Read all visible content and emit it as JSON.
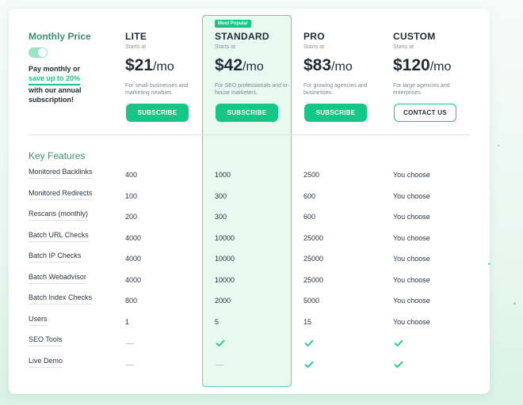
{
  "monthly_price": {
    "title": "Monthly Price",
    "pay_line1": "Pay monthly or",
    "save_text": "save up to 20%",
    "pay_line2": "with our annual subscription!"
  },
  "popular_badge": "Most Popular",
  "plans": [
    {
      "name": "LITE",
      "starts": "Starts at",
      "price": "$21",
      "per": "/mo",
      "desc": "For small businesses and marketing newbies.",
      "button": "SUBSCRIBE"
    },
    {
      "name": "STANDARD",
      "starts": "Starts at",
      "price": "$42",
      "per": "/mo",
      "desc": "For SEO professionals and in-house marketers.",
      "button": "SUBSCRIBE"
    },
    {
      "name": "PRO",
      "starts": "Starts at",
      "price": "$83",
      "per": "/mo",
      "desc": "For growing agencies and businesses.",
      "button": "SUBSCRIBE"
    },
    {
      "name": "CUSTOM",
      "starts": "Starts at",
      "price": "$120",
      "per": "/mo",
      "desc": "For large agencies and enterprises.",
      "button": "CONTACT US"
    }
  ],
  "key_features_title": "Key Features",
  "features": [
    {
      "label": "Monitored Backlinks",
      "values": [
        "400",
        "1000",
        "2500",
        "You choose"
      ]
    },
    {
      "label": "Monitored Redirects",
      "values": [
        "100",
        "300",
        "600",
        "You choose"
      ]
    },
    {
      "label": "Rescans (monthly)",
      "values": [
        "200",
        "300",
        "600",
        "You choose"
      ]
    },
    {
      "label": "Batch URL Checks",
      "values": [
        "4000",
        "10000",
        "25000",
        "You choose"
      ]
    },
    {
      "label": "Batch IP Checks",
      "values": [
        "4000",
        "10000",
        "25000",
        "You choose"
      ]
    },
    {
      "label": "Batch Webadvisor",
      "values": [
        "4000",
        "10000",
        "25000",
        "You choose"
      ]
    },
    {
      "label": "Batch Index Checks",
      "values": [
        "800",
        "2000",
        "5000",
        "You choose"
      ]
    },
    {
      "label": "Users",
      "values": [
        "1",
        "5",
        "15",
        "You choose"
      ]
    },
    {
      "label": "SEO Tools",
      "values": [
        "dash",
        "check",
        "check",
        "check"
      ]
    },
    {
      "label": "Live Demo",
      "values": [
        "dash",
        "dash",
        "check",
        "check"
      ]
    }
  ],
  "colors": {
    "accent": "#14c787",
    "highlight_bg": "#e8f9f1",
    "heading_green": "#3c8f6e"
  },
  "icons": {
    "included": "check-icon",
    "not_included": "dash-icon"
  }
}
